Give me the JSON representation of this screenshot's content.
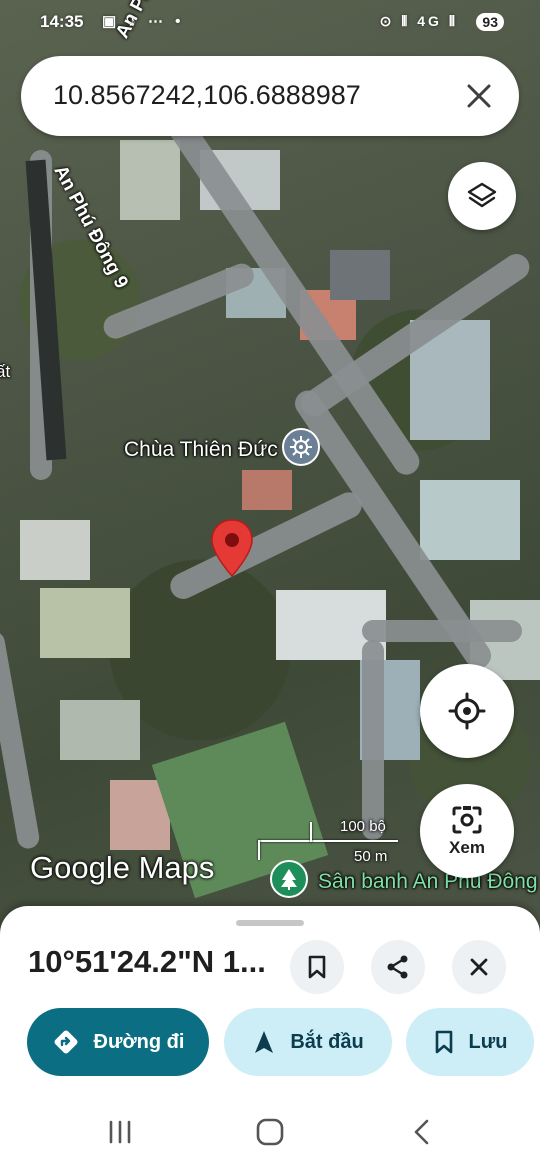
{
  "status_bar": {
    "time": "14:35",
    "left_icons": "▣ ♪ ⋯ •",
    "right_icons": "⊙ ⦀ 4G ⦀",
    "battery": "93"
  },
  "search": {
    "value": "10.8567242,106.6888987",
    "close_icon": "close-icon"
  },
  "map": {
    "street_labels": [
      "An Phú Đông 9",
      "An Phú Đô"
    ],
    "poi_label": "Chùa Thiên Đức",
    "park_label": "Sân banh An Phú Đông",
    "side_label": "ất",
    "logo": "Google Maps",
    "scale_feet": "100 bộ",
    "scale_meters": "50 m",
    "pin_color": "#e53935"
  },
  "controls": {
    "layers_icon": "layers-icon",
    "locate_icon": "my-location-icon",
    "lens_label": "Xem"
  },
  "sheet": {
    "title": "10°51'24.2\"N 1...",
    "actions": {
      "directions": "Đường đi",
      "start": "Bắt đầu",
      "save": "Lưu"
    },
    "accent_color": "#0b6e82"
  },
  "nav": {
    "recent_icon": "recents-icon",
    "home_icon": "home-icon",
    "back_icon": "back-icon"
  }
}
